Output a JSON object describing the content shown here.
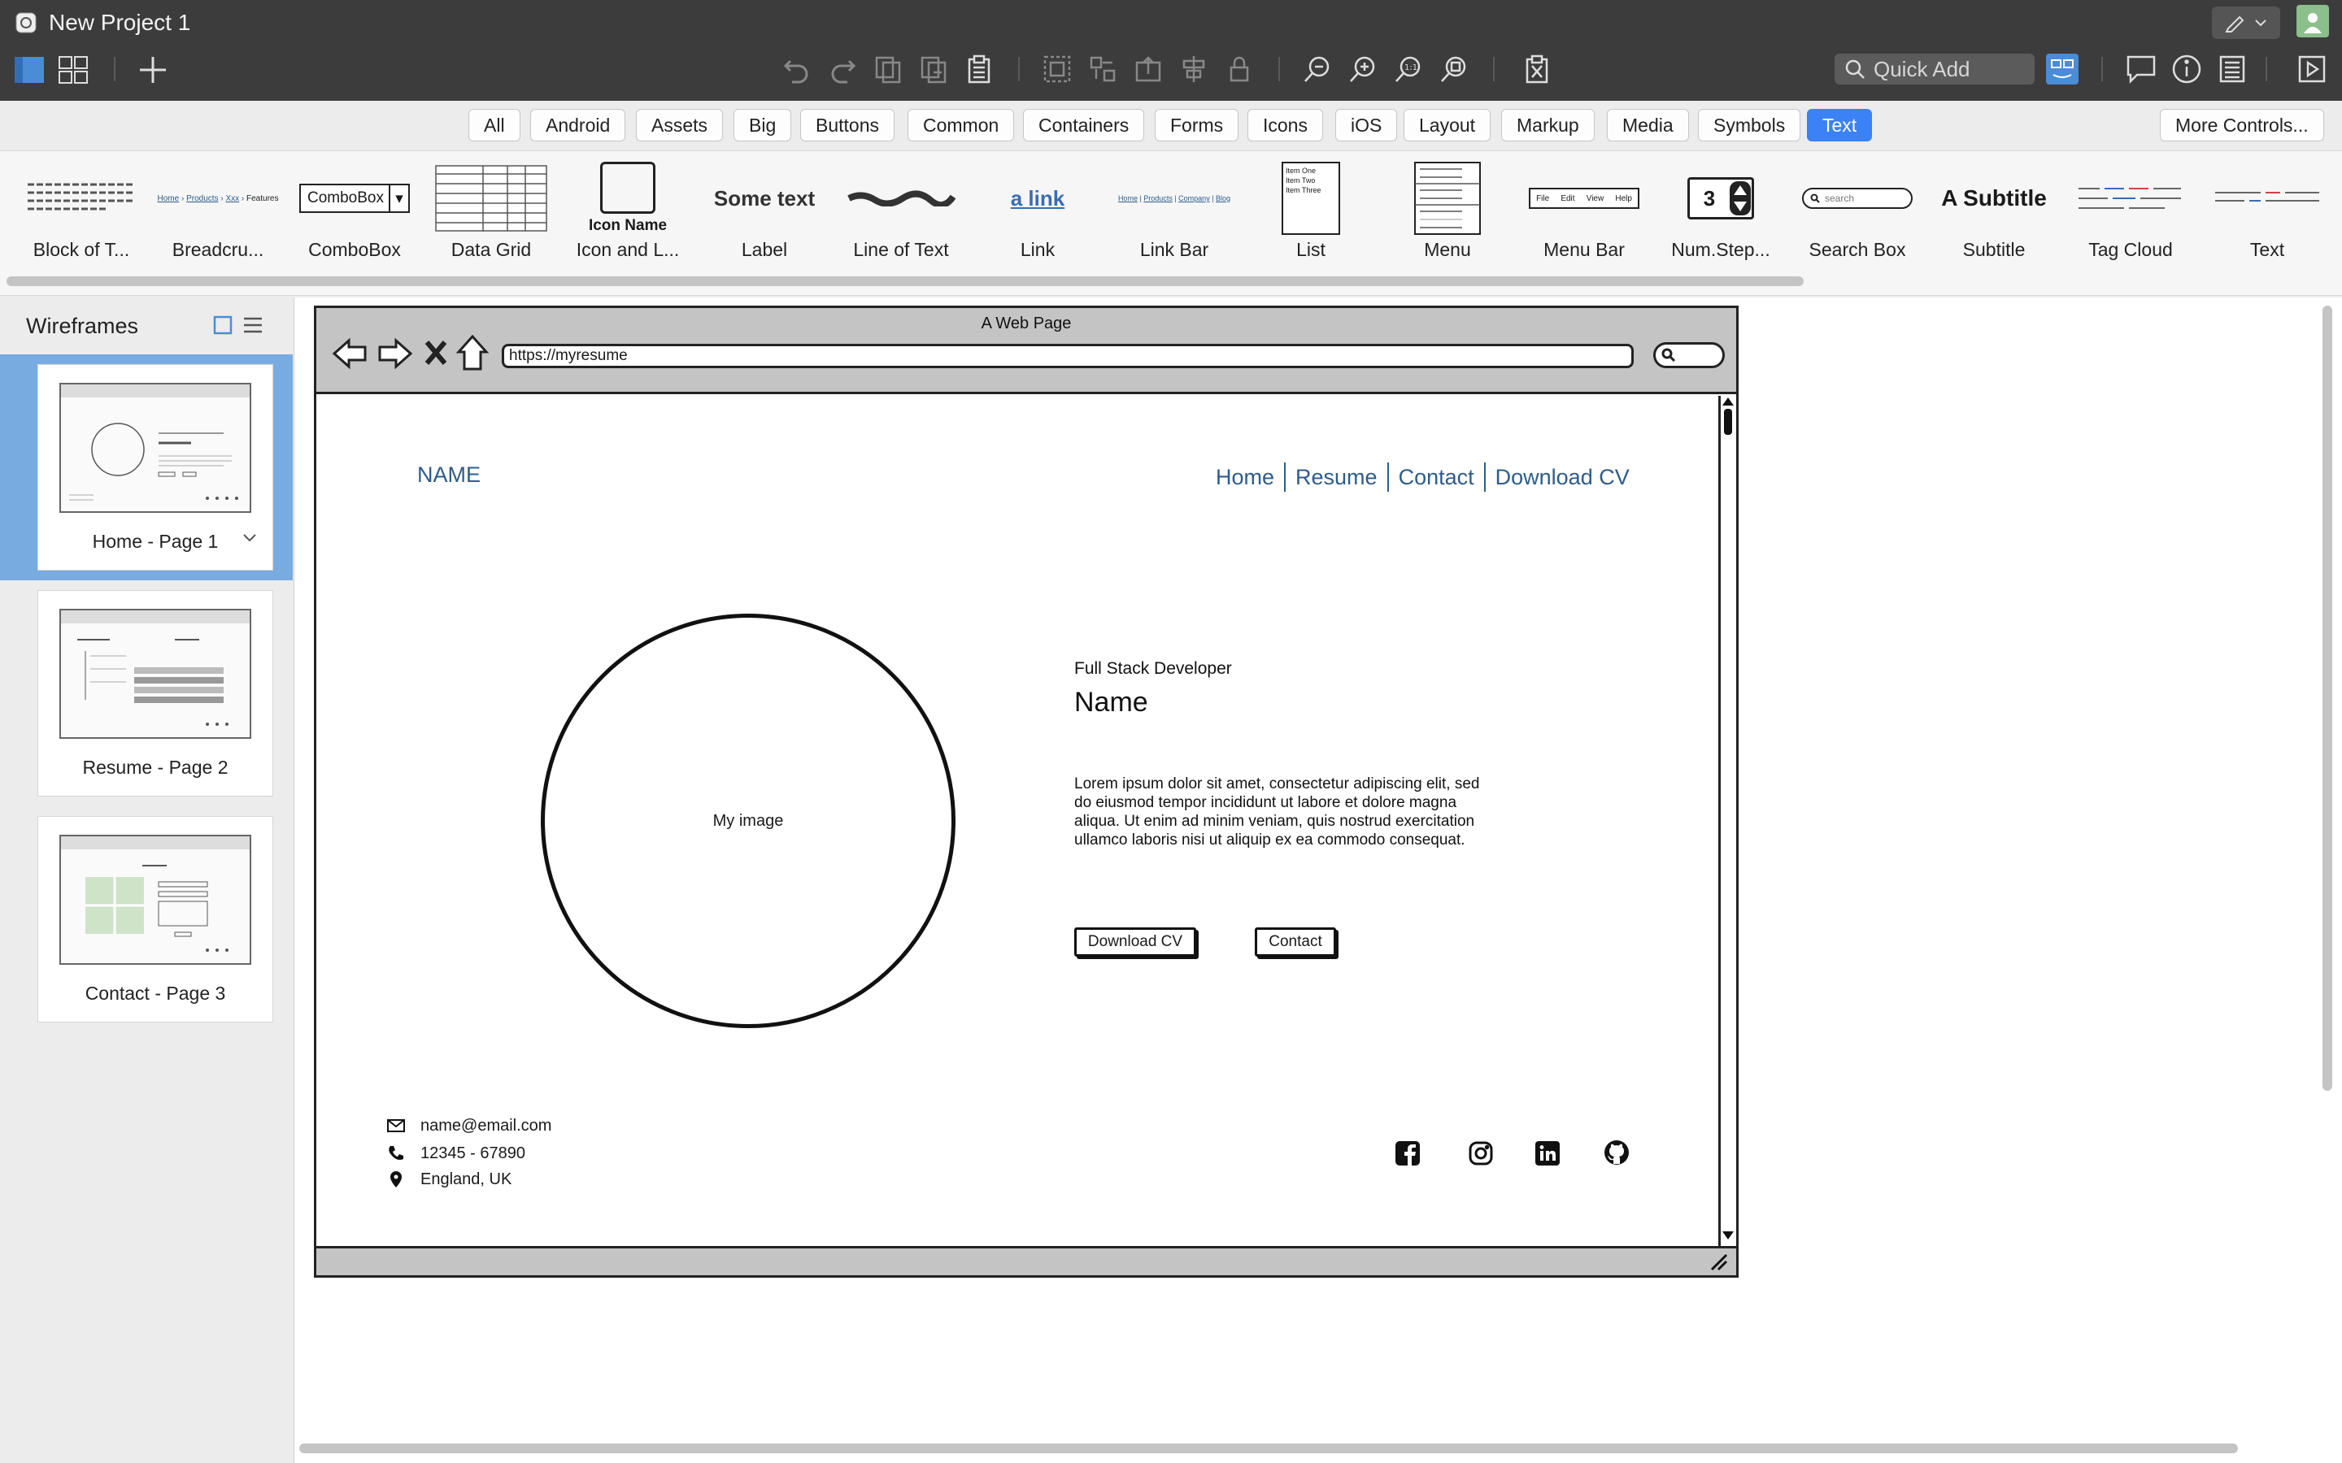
{
  "app": {
    "title": "New Project 1"
  },
  "toolbar": {
    "quick_add_placeholder": "Quick Add"
  },
  "filters": [
    "All",
    "Android",
    "Assets",
    "Big",
    "Buttons",
    "Common",
    "Containers",
    "Forms",
    "Icons",
    "iOS",
    "Layout",
    "Markup",
    "Media",
    "Symbols",
    "Text"
  ],
  "active_filter": "Text",
  "more_controls": "More Controls...",
  "library": {
    "items": [
      "Block of T...",
      "Breadcru...",
      "ComboBox",
      "Data Grid",
      "Icon and L...",
      "Label",
      "Line of Text",
      "Link",
      "Link Bar",
      "List",
      "Menu",
      "Menu Bar",
      "Num.Step...",
      "Search Box",
      "Subtitle",
      "Tag Cloud",
      "Text"
    ],
    "thumbs": {
      "combobox": "ComboBox",
      "icon_name": "Icon Name",
      "label": "Some text",
      "link": "a link",
      "numstep": "3",
      "search": "search",
      "subtitle": "A Subtitle",
      "list": [
        "Item One",
        "Item Two",
        "Item Three"
      ],
      "menubar": [
        "File",
        "Edit",
        "View",
        "Help"
      ],
      "breadcrumb": [
        "Home",
        "Products",
        "Xxx",
        "Features"
      ],
      "linkbar": [
        "Home",
        "Products",
        "Company",
        "Blog"
      ]
    }
  },
  "sidebar": {
    "title": "Wireframes",
    "pages": [
      "Home - Page 1",
      "Resume - Page 2",
      "Contact - Page 3"
    ]
  },
  "wireframe": {
    "browser_title": "A Web Page",
    "url": "https://myresume",
    "brand": "NAME",
    "nav": [
      "Home",
      "Resume",
      "Contact",
      "Download CV"
    ],
    "image_label": "My image",
    "role": "Full Stack Developer",
    "name": "Name",
    "bio": "Lorem ipsum dolor sit amet, consectetur adipiscing elit, sed do eiusmod tempor incididunt ut labore et dolore magna aliqua. Ut enim ad minim veniam, quis nostrud exercitation ullamco laboris nisi ut aliquip ex ea commodo consequat.",
    "btn_download": "Download CV",
    "btn_contact": "Contact",
    "email": "name@email.com",
    "phone": "12345 - 67890",
    "location": "England, UK"
  }
}
